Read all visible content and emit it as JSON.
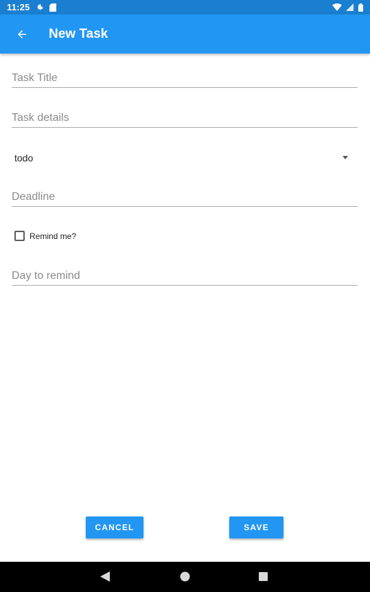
{
  "status_bar": {
    "time": "11:25",
    "icons": [
      "settings-icon",
      "sd-card-icon",
      "wifi-icon",
      "signal-icon",
      "battery-icon"
    ]
  },
  "app_bar": {
    "title": "New Task",
    "back_icon": "arrow-back-icon",
    "color": "#2196f3"
  },
  "form": {
    "title_field": {
      "value": "",
      "placeholder": "Task Title"
    },
    "details_field": {
      "value": "",
      "placeholder": "Task details"
    },
    "status_select": {
      "selected": "todo"
    },
    "deadline_field": {
      "value": "",
      "placeholder": "Deadline"
    },
    "remind_checkbox": {
      "label": "Remind me?",
      "checked": false
    },
    "remind_day_field": {
      "value": "",
      "placeholder": "Day to remind"
    }
  },
  "actions": {
    "cancel_label": "CANCEL",
    "save_label": "SAVE"
  },
  "nav_bar": {
    "icons": [
      "back-nav-icon",
      "home-nav-icon",
      "recents-nav-icon"
    ]
  }
}
